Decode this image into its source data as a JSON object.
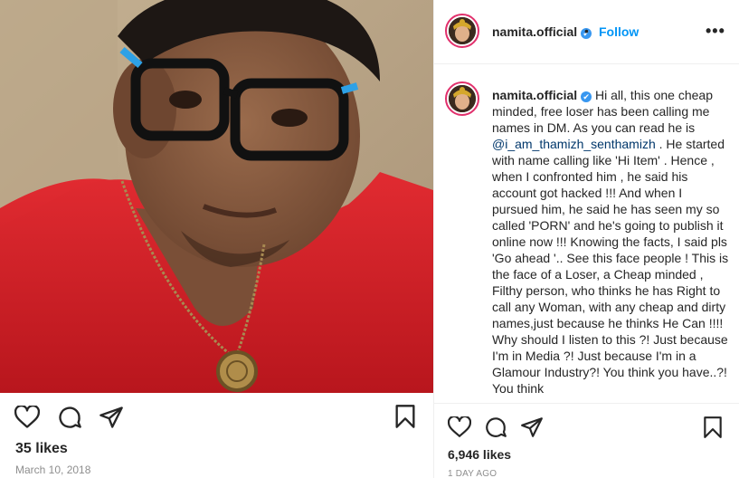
{
  "post": {
    "author": "namita.official",
    "follow_label": "Follow",
    "separator": "•",
    "more_label": "•••",
    "verified_symbol": "✔",
    "caption_user": "namita.official",
    "caption_before_mention": "Hi all, this one cheap minded, free loser has been calling me names in DM. As you can read he is ",
    "caption_mention": "@i_am_thamizh_senthamizh",
    "caption_after_mention": " . He started with name calling like 'Hi Item' . Hence , when I confronted him , he said his account got hacked !!! And when I pursued him, he said he has seen my so called 'PORN' and he's going to publish it online now !!! Knowing the facts, I said pls 'Go ahead '.. See this face people ! This is the face of a Loser, a Cheap minded , Filthy person, who thinks he has Right to call any Woman, with any cheap and dirty names,just because he thinks He Can !!!! Why should I listen to this ?! Just because I'm in Media ?! Just because I'm in a Glamour Industry?! You think you have..?! You think",
    "likes_right": "6,946 likes",
    "time_right": "1 DAY AGO"
  },
  "left_post": {
    "likes": "35 likes",
    "date": "March 10, 2018"
  },
  "icons": {
    "like": "heart-icon",
    "comment": "comment-icon",
    "share": "share-icon",
    "save": "bookmark-icon"
  },
  "colors": {
    "follow": "#0095f6",
    "verified": "#3897f0",
    "shirt": "#d8232a",
    "story_ring": "#e1306c"
  }
}
